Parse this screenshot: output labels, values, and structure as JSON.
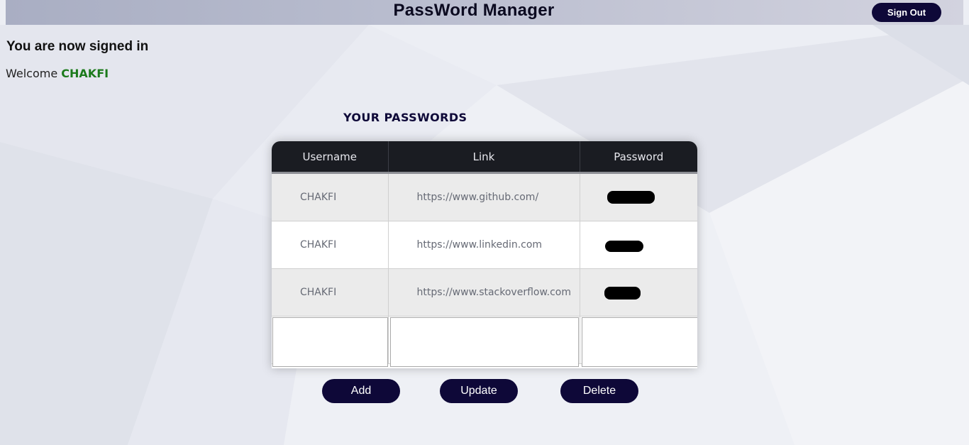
{
  "app": {
    "title": "PassWord Manager",
    "signout_label": "Sign Out"
  },
  "status": {
    "signed_in_text": "You are now signed in",
    "welcome_prefix": "Welcome",
    "username": "CHAKFI"
  },
  "section_title": "YOUR PASSWORDS",
  "table": {
    "headers": [
      "Username",
      "Link",
      "Password"
    ],
    "rows": [
      {
        "username": "CHAKFI",
        "link": "https://www.github.com/",
        "password_mask": "redacted"
      },
      {
        "username": "CHAKFI",
        "link": "https://www.linkedin.com",
        "password_mask": "redacted"
      },
      {
        "username": "CHAKFI",
        "link": "https://www.stackoverflow.com",
        "password_mask": "redacted"
      }
    ]
  },
  "inputs": {
    "username_value": "",
    "link_value": "",
    "password_value": ""
  },
  "actions": {
    "add_label": "Add",
    "update_label": "Update",
    "delete_label": "Delete"
  },
  "colors": {
    "accent": "#0e0838",
    "welcome_name": "#1b7a1b",
    "table_header": "#1a1c22"
  }
}
